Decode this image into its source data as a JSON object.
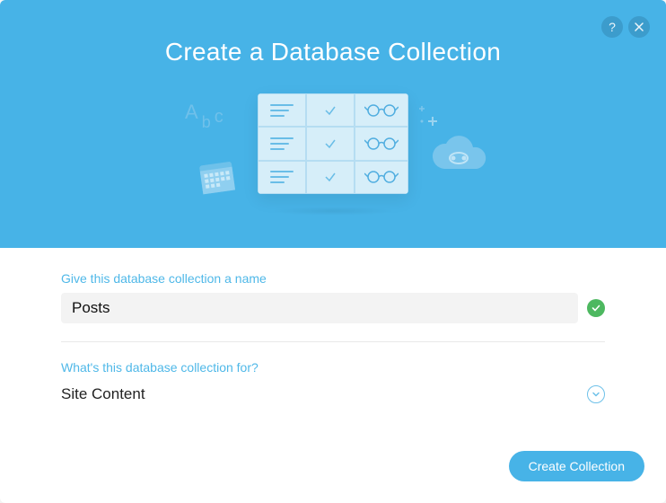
{
  "modal": {
    "title": "Create a Database Collection",
    "help_tooltip": "?"
  },
  "form": {
    "name_label": "Give this database collection a name",
    "name_value": "Posts",
    "purpose_label": "What's this database collection for?",
    "purpose_value": "Site Content"
  },
  "actions": {
    "submit_label": "Create Collection"
  },
  "illustration": {
    "abc": "Abc"
  }
}
